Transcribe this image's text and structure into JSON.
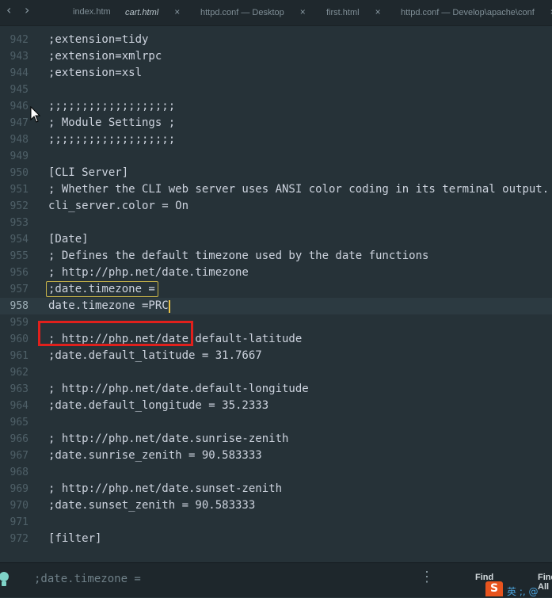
{
  "tabs": [
    {
      "label": "index.htm",
      "active": false,
      "closable": false
    },
    {
      "label": "cart.html",
      "active": true,
      "closable": true
    },
    {
      "label": "httpd.conf — Desktop",
      "active": false,
      "closable": true
    },
    {
      "label": "first.html",
      "active": false,
      "closable": true
    },
    {
      "label": "httpd.conf — Develop\\apache\\conf",
      "active": false,
      "closable": true
    }
  ],
  "nav": {
    "back": "‹",
    "forward": "›"
  },
  "close_glyph": "×",
  "editor": {
    "current_line": 958,
    "lines": [
      {
        "n": "942",
        "text": ";extension=tidy"
      },
      {
        "n": "943",
        "text": ";extension=xmlrpc"
      },
      {
        "n": "944",
        "text": ";extension=xsl"
      },
      {
        "n": "945",
        "text": ""
      },
      {
        "n": "946",
        "text": ";;;;;;;;;;;;;;;;;;;"
      },
      {
        "n": "947",
        "text": "; Module Settings ;"
      },
      {
        "n": "948",
        "text": ";;;;;;;;;;;;;;;;;;;"
      },
      {
        "n": "949",
        "text": ""
      },
      {
        "n": "950",
        "text": "[CLI Server]"
      },
      {
        "n": "951",
        "text": "; Whether the CLI web server uses ANSI color coding in its terminal output."
      },
      {
        "n": "952",
        "text": "cli_server.color = On"
      },
      {
        "n": "953",
        "text": ""
      },
      {
        "n": "954",
        "text": "[Date]"
      },
      {
        "n": "955",
        "text": "; Defines the default timezone used by the date functions"
      },
      {
        "n": "956",
        "text": "; http://php.net/date.timezone"
      },
      {
        "n": "957",
        "text": ";date.timezone ="
      },
      {
        "n": "958",
        "text": "date.timezone =PRC"
      },
      {
        "n": "959",
        "text": ""
      },
      {
        "n": "960",
        "text": "; http://php.net/date.default-latitude"
      },
      {
        "n": "961",
        "text": ";date.default_latitude = 31.7667"
      },
      {
        "n": "962",
        "text": ""
      },
      {
        "n": "963",
        "text": "; http://php.net/date.default-longitude"
      },
      {
        "n": "964",
        "text": ";date.default_longitude = 35.2333"
      },
      {
        "n": "965",
        "text": ""
      },
      {
        "n": "966",
        "text": "; http://php.net/date.sunrise-zenith"
      },
      {
        "n": "967",
        "text": ";date.sunrise_zenith = 90.583333"
      },
      {
        "n": "968",
        "text": ""
      },
      {
        "n": "969",
        "text": "; http://php.net/date.sunset-zenith"
      },
      {
        "n": "970",
        "text": ";date.sunset_zenith = 90.583333"
      },
      {
        "n": "971",
        "text": ""
      },
      {
        "n": "972",
        "text": "[filter]"
      }
    ]
  },
  "find_panel": {
    "query": ";date.timezone =",
    "menu_glyph": "⋮",
    "find_label": "Find",
    "find_all_label": "Find All"
  },
  "ime": {
    "logo": "S",
    "text": "英 ;, @"
  },
  "colors": {
    "background": "#263238",
    "text": "#cdd3de",
    "highlight": "#e0201c",
    "find_match": "#c8b44a"
  }
}
